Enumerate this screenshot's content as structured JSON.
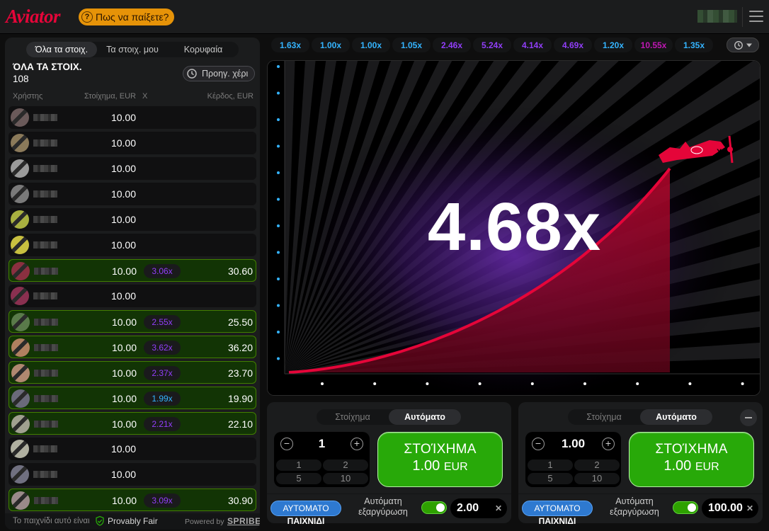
{
  "header": {
    "logo": "Aviator",
    "how_to_play": "Πως να παίξετε?",
    "colors": {
      "brand": "#e50539",
      "help_button": "#e69308"
    }
  },
  "bets_panel": {
    "tabs": [
      {
        "label": "Όλα τα στοιχ.",
        "active": true
      },
      {
        "label": "Τα στοιχ. μου",
        "active": false
      },
      {
        "label": "Κορυφαία",
        "active": false
      }
    ],
    "title": "ΌΛΑ ΤΑ ΣΤΟΙΧ.",
    "count": "108",
    "prev_hand_label": "Προηγ. χέρι",
    "columns": {
      "user": "Χρήστης",
      "bet": "Στοίχημα, EUR",
      "x": "X",
      "win": "Κέρδος, EUR"
    },
    "rows": [
      {
        "bet": "10.00",
        "mult": "",
        "win": "",
        "won": false,
        "mult_color": "",
        "avatar": "#6a5a5a"
      },
      {
        "bet": "10.00",
        "mult": "",
        "win": "",
        "won": false,
        "mult_color": "",
        "avatar": "#8b7a5a"
      },
      {
        "bet": "10.00",
        "mult": "",
        "win": "",
        "won": false,
        "mult_color": "",
        "avatar": "#9a9a9a"
      },
      {
        "bet": "10.00",
        "mult": "",
        "win": "",
        "won": false,
        "mult_color": "",
        "avatar": "#7a7a7a"
      },
      {
        "bet": "10.00",
        "mult": "",
        "win": "",
        "won": false,
        "mult_color": "",
        "avatar": "#a8b040"
      },
      {
        "bet": "10.00",
        "mult": "",
        "win": "",
        "won": false,
        "mult_color": "",
        "avatar": "#c8c040"
      },
      {
        "bet": "10.00",
        "mult": "3.06x",
        "win": "30.60",
        "won": true,
        "mult_color": "#913ef8",
        "avatar": "#8a3040"
      },
      {
        "bet": "10.00",
        "mult": "",
        "win": "",
        "won": false,
        "mult_color": "",
        "avatar": "#8a3050"
      },
      {
        "bet": "10.00",
        "mult": "2.55x",
        "win": "25.50",
        "won": true,
        "mult_color": "#913ef8",
        "avatar": "#5a7a4a"
      },
      {
        "bet": "10.00",
        "mult": "3.62x",
        "win": "36.20",
        "won": true,
        "mult_color": "#913ef8",
        "avatar": "#b08060"
      },
      {
        "bet": "10.00",
        "mult": "2.37x",
        "win": "23.70",
        "won": true,
        "mult_color": "#913ef8",
        "avatar": "#b08870"
      },
      {
        "bet": "10.00",
        "mult": "1.99x",
        "win": "19.90",
        "won": true,
        "mult_color": "#34b4ff",
        "avatar": "#6a6a7a"
      },
      {
        "bet": "10.00",
        "mult": "2.21x",
        "win": "22.10",
        "won": true,
        "mult_color": "#913ef8",
        "avatar": "#a0a090"
      },
      {
        "bet": "10.00",
        "mult": "",
        "win": "",
        "won": false,
        "mult_color": "",
        "avatar": "#b0b0a0"
      },
      {
        "bet": "10.00",
        "mult": "",
        "win": "",
        "won": false,
        "mult_color": "",
        "avatar": "#707080"
      },
      {
        "bet": "10.00",
        "mult": "3.09x",
        "win": "30.90",
        "won": true,
        "mult_color": "#913ef8",
        "avatar": "#9a8a8a"
      }
    ],
    "footer": {
      "no_game": "Το παιχνίδι αυτό είναι",
      "provably_fair": "Provably Fair",
      "powered_by": "Powered by",
      "spribe": "SPRIBE"
    }
  },
  "history": [
    {
      "value": "1.63x",
      "color": "#34b4ff"
    },
    {
      "value": "1.00x",
      "color": "#34b4ff"
    },
    {
      "value": "1.00x",
      "color": "#34b4ff"
    },
    {
      "value": "1.05x",
      "color": "#34b4ff"
    },
    {
      "value": "2.46x",
      "color": "#913ef8"
    },
    {
      "value": "5.24x",
      "color": "#913ef8"
    },
    {
      "value": "4.14x",
      "color": "#913ef8"
    },
    {
      "value": "4.69x",
      "color": "#913ef8"
    },
    {
      "value": "1.20x",
      "color": "#34b4ff"
    },
    {
      "value": "10.55x",
      "color": "#c017b4"
    },
    {
      "value": "1.35x",
      "color": "#34b4ff"
    }
  ],
  "game": {
    "multiplier": "4.68x",
    "curve_color": "#e50539"
  },
  "bet_panels": [
    {
      "tabs": [
        {
          "label": "Στοίχημα",
          "active": false
        },
        {
          "label": "Αυτόματο",
          "active": true
        }
      ],
      "stake": "1",
      "quick_amounts": [
        "1",
        "2",
        "5",
        "10"
      ],
      "bet_button": {
        "line1": "ΣΤΟΊΧΗΜΑ",
        "amount": "1.00",
        "currency": "EUR"
      },
      "autoplay": {
        "line1": "ΑΥΤΟΜΑΤΟ",
        "line2": "ΠΑΙΧΝΙΔΙ"
      },
      "auto_cashout_label": {
        "line1": "Αυτόματη",
        "line2": "εξαργύρωση"
      },
      "auto_cashout_enabled": true,
      "cashout_value": "2.00",
      "has_collapse": false
    },
    {
      "tabs": [
        {
          "label": "Στοίχημα",
          "active": false
        },
        {
          "label": "Αυτόματο",
          "active": true
        }
      ],
      "stake": "1.00",
      "quick_amounts": [
        "1",
        "2",
        "5",
        "10"
      ],
      "bet_button": {
        "line1": "ΣΤΟΊΧΗΜΑ",
        "amount": "1.00",
        "currency": "EUR"
      },
      "autoplay": {
        "line1": "ΑΥΤΟΜΑΤΟ",
        "line2": "ΠΑΙΧΝΙΔΙ"
      },
      "auto_cashout_label": {
        "line1": "Αυτόματη",
        "line2": "εξαργύρωση"
      },
      "auto_cashout_enabled": true,
      "cashout_value": "100.00",
      "has_collapse": true
    }
  ]
}
